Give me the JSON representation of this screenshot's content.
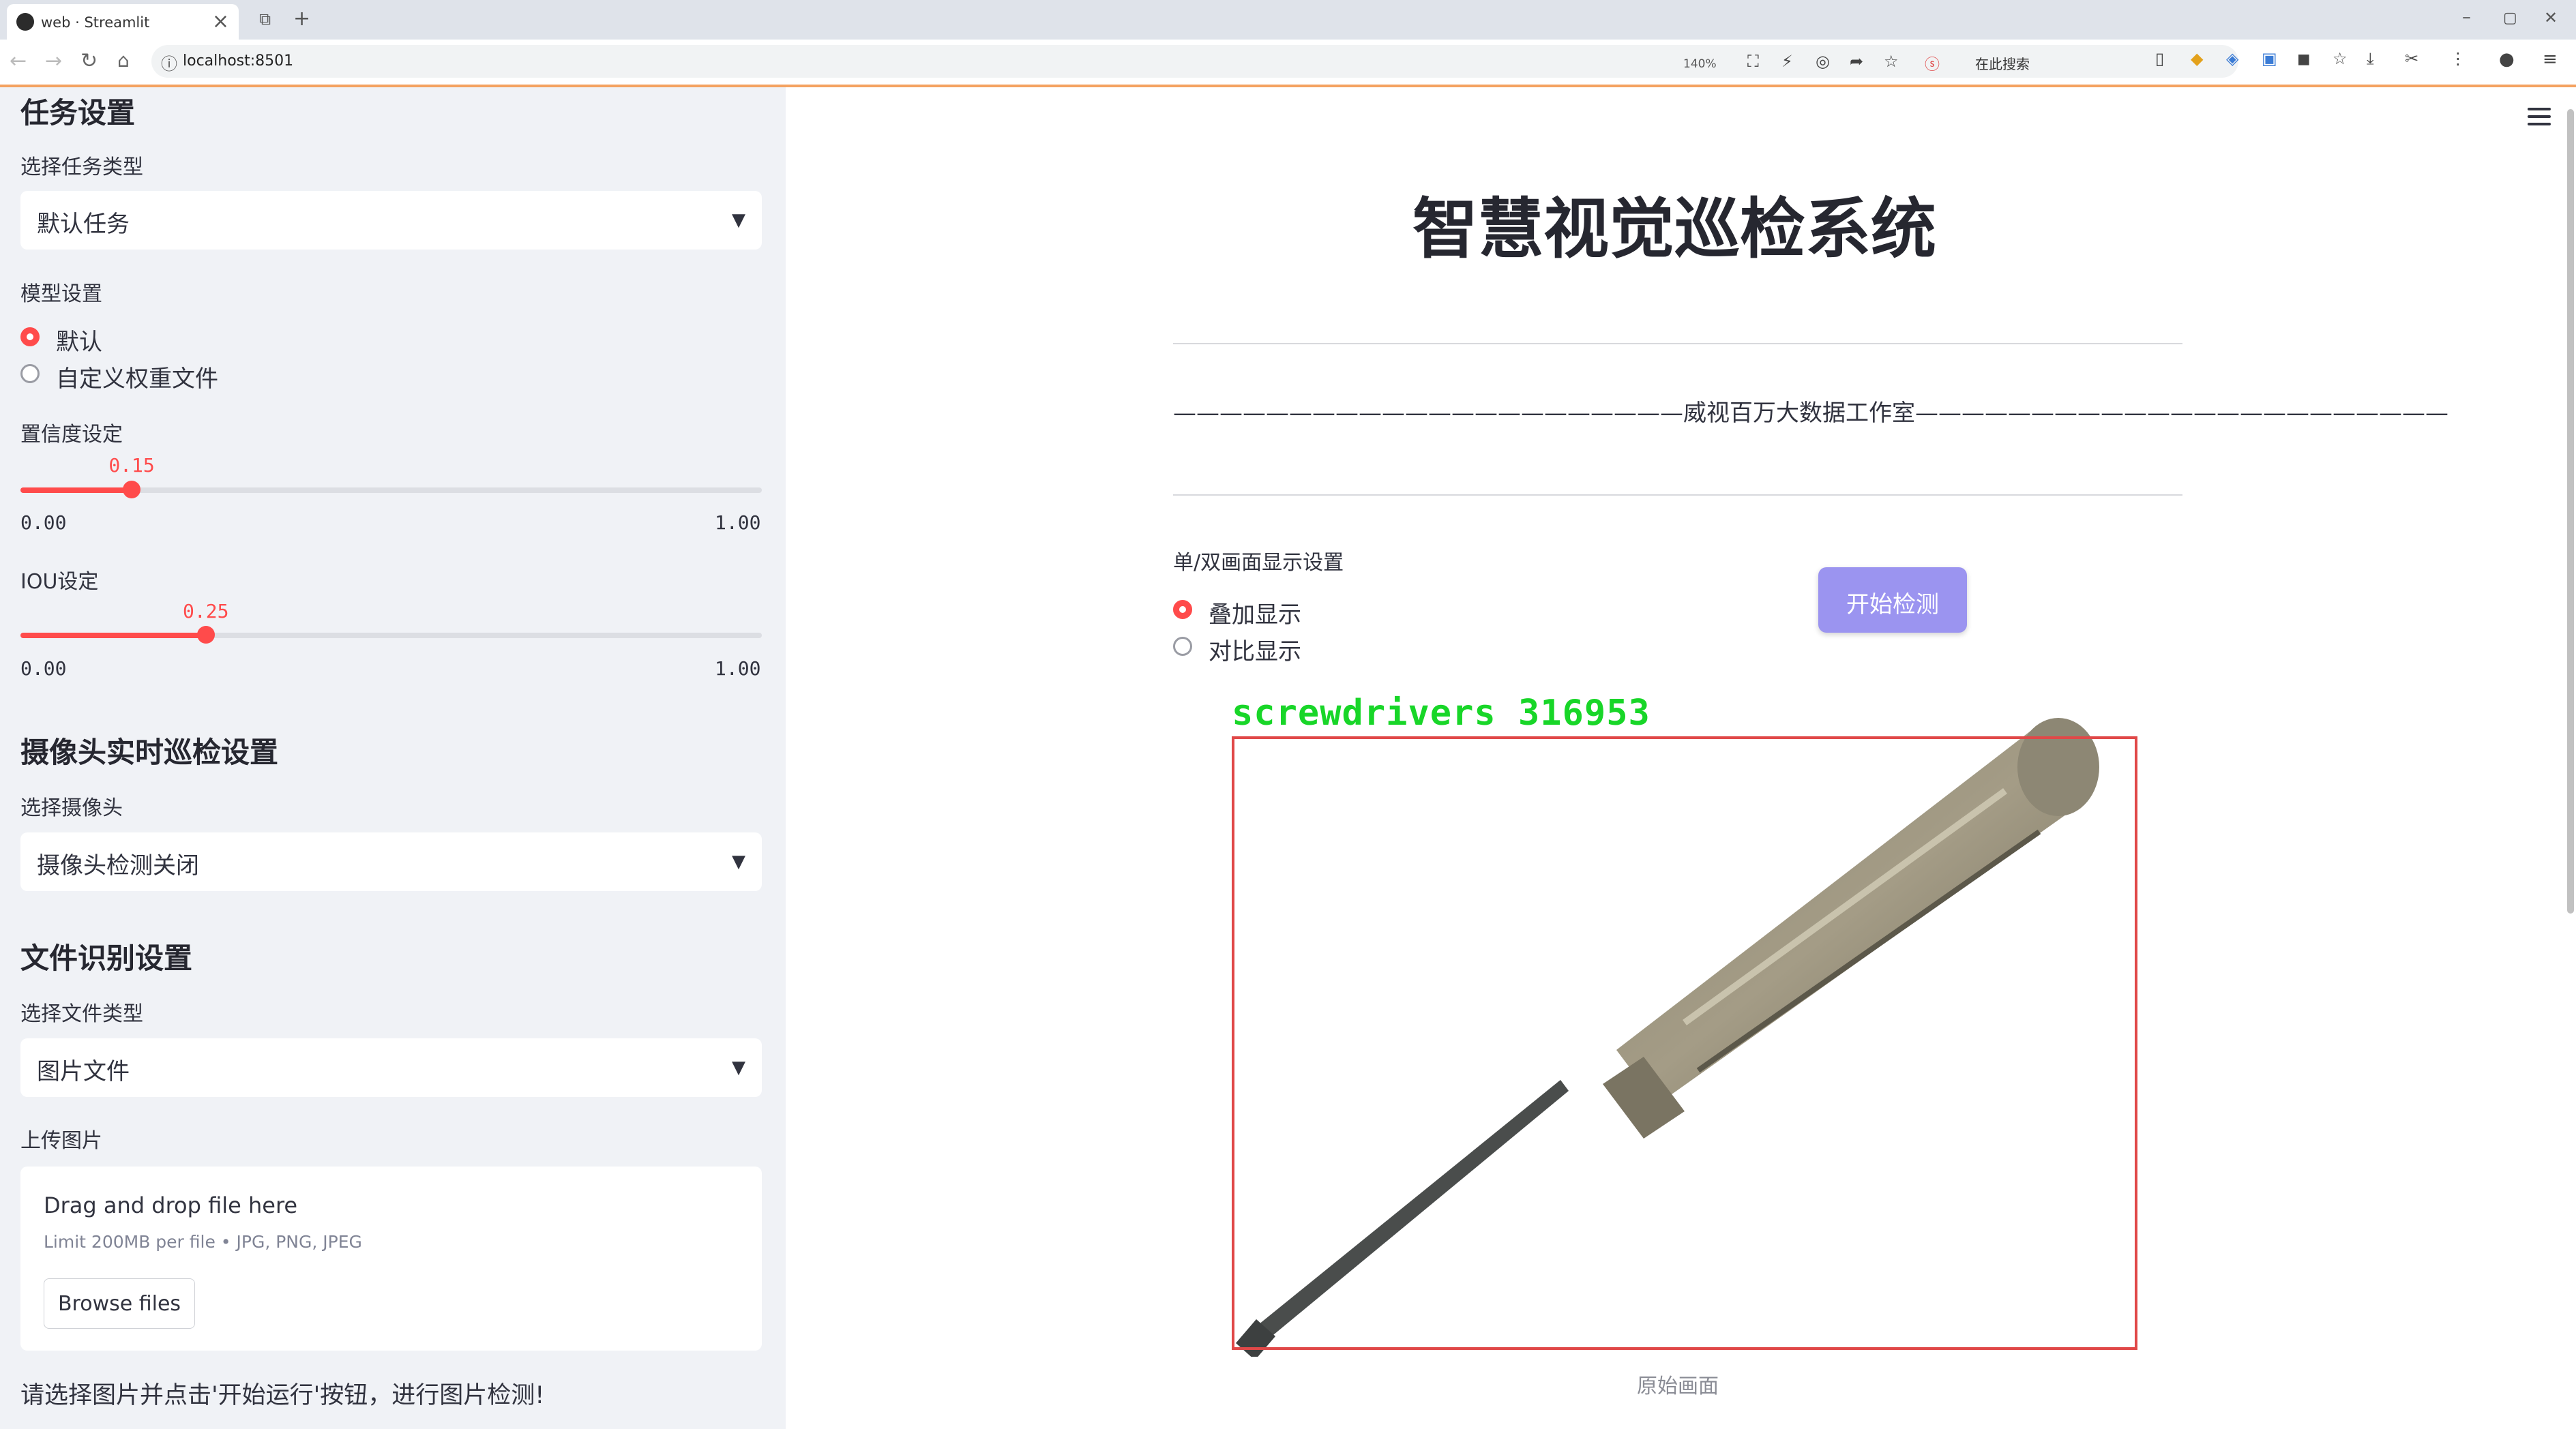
{
  "browser": {
    "tab_title": "web · Streamlit",
    "tab_close": "×",
    "new_tab": "+",
    "url": "localhost:8501",
    "zoom": "140%",
    "search_label": "在此搜索",
    "window_controls": [
      "–",
      "▢",
      "✕"
    ]
  },
  "sidebar": {
    "task_heading": "任务设置",
    "task_type_label": "选择任务类型",
    "task_type_value": "默认任务",
    "model_label": "模型设置",
    "model_options": [
      "默认",
      "自定义权重文件"
    ],
    "model_selected": "默认",
    "confidence_label": "置信度设定",
    "confidence_value": "0.15",
    "confidence_min": "0.00",
    "confidence_max": "1.00",
    "confidence": 0.15,
    "iou_label": "IOU设定",
    "iou_value": "0.25",
    "iou_min": "0.00",
    "iou_max": "1.00",
    "iou": 0.25,
    "camera_heading": "摄像头实时巡检设置",
    "camera_label": "选择摄像头",
    "camera_value": "摄像头检测关闭",
    "file_heading": "文件识别设置",
    "file_type_label": "选择文件类型",
    "file_type_value": "图片文件",
    "upload_label": "上传图片",
    "upload_title": "Drag and drop file here",
    "upload_limit": "Limit 200MB per file • JPG, PNG, JPEG",
    "browse_button": "Browse files",
    "note": "请选择图片并点击'开始运行'按钮，进行图片检测!"
  },
  "main": {
    "title": "智慧视觉巡检系统",
    "banner": "——————————————————————威视百万大数据工作室———————————————————————",
    "display_label": "单/双画面显示设置",
    "display_options": [
      "叠加显示",
      "对比显示"
    ],
    "display_selected": "叠加显示",
    "start_button": "开始检测",
    "detection_label": "screwdrivers 316953",
    "caption": "原始画面"
  },
  "colors": {
    "accent": "#ff4b4b",
    "sidebar_bg": "#f0f2f6",
    "start_button": "#9b94f0",
    "detection_text": "#18d628",
    "detection_box": "#e04848"
  },
  "icons": [
    "streamlit-logo-icon",
    "back-icon",
    "forward-icon",
    "reload-icon",
    "home-icon",
    "menu-icon",
    "dropdown-arrow-icon",
    "screwdriver-image"
  ]
}
